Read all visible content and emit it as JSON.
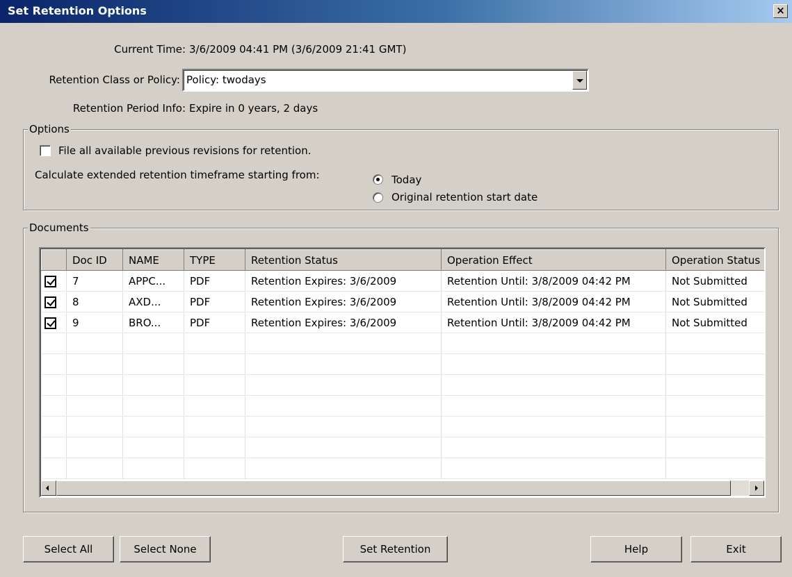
{
  "window": {
    "title": "Set Retention Options",
    "close_glyph": "×"
  },
  "info": {
    "current_time_label": "Current Time:",
    "current_time_value": "3/6/2009 04:41 PM (3/6/2009 21:41 GMT)",
    "retention_class_label": "Retention Class or Policy:",
    "retention_class_value": "Policy: twodays",
    "retention_period_label": "Retention Period Info:",
    "retention_period_value": "Expire in 0 years, 2 days"
  },
  "options": {
    "legend": "Options",
    "file_revisions_label": "File all available previous revisions for retention.",
    "file_revisions_checked": false,
    "calc_label": "Calculate extended retention timeframe starting from:",
    "radio_today": "Today",
    "radio_original": "Original retention start date",
    "selected": "Today"
  },
  "documents": {
    "legend": "Documents",
    "columns": [
      "",
      "Doc ID",
      "NAME",
      "TYPE",
      "Retention Status",
      "Operation Effect",
      "Operation Status"
    ],
    "rows": [
      {
        "checked": true,
        "doc_id": "7",
        "name": "APPC...",
        "type": "PDF",
        "retention_status": "Retention Expires: 3/6/2009",
        "operation_effect": "Retention Until: 3/8/2009 04:42 PM",
        "operation_status": "Not Submitted"
      },
      {
        "checked": true,
        "doc_id": "8",
        "name": "AXD...",
        "type": "PDF",
        "retention_status": "Retention Expires: 3/6/2009",
        "operation_effect": "Retention Until: 3/8/2009 04:42 PM",
        "operation_status": "Not Submitted"
      },
      {
        "checked": true,
        "doc_id": "9",
        "name": "BRO...",
        "type": "PDF",
        "retention_status": "Retention Expires: 3/6/2009",
        "operation_effect": "Retention Until: 3/8/2009 04:42 PM",
        "operation_status": "Not Submitted"
      }
    ]
  },
  "buttons": {
    "select_all": "Select All",
    "select_none": "Select None",
    "set_retention": "Set Retention",
    "help": "Help",
    "exit": "Exit"
  },
  "colors": {
    "title_bar": "#0a246a",
    "window_bg": "#d4d0c8"
  }
}
